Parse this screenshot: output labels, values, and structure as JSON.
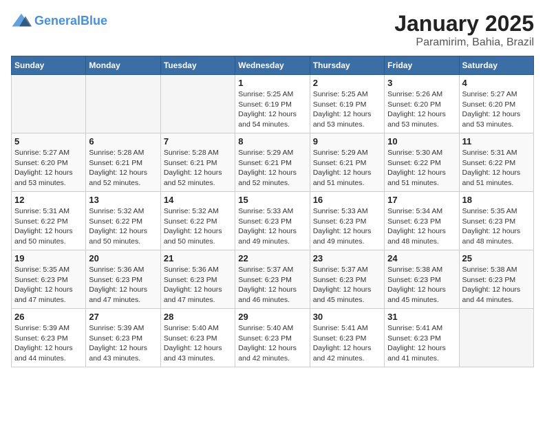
{
  "logo": {
    "line1": "General",
    "line2": "Blue"
  },
  "title": "January 2025",
  "subtitle": "Paramirim, Bahia, Brazil",
  "days_of_week": [
    "Sunday",
    "Monday",
    "Tuesday",
    "Wednesday",
    "Thursday",
    "Friday",
    "Saturday"
  ],
  "weeks": [
    [
      {
        "day": "",
        "info": ""
      },
      {
        "day": "",
        "info": ""
      },
      {
        "day": "",
        "info": ""
      },
      {
        "day": "1",
        "info": "Sunrise: 5:25 AM\nSunset: 6:19 PM\nDaylight: 12 hours\nand 54 minutes."
      },
      {
        "day": "2",
        "info": "Sunrise: 5:25 AM\nSunset: 6:19 PM\nDaylight: 12 hours\nand 53 minutes."
      },
      {
        "day": "3",
        "info": "Sunrise: 5:26 AM\nSunset: 6:20 PM\nDaylight: 12 hours\nand 53 minutes."
      },
      {
        "day": "4",
        "info": "Sunrise: 5:27 AM\nSunset: 6:20 PM\nDaylight: 12 hours\nand 53 minutes."
      }
    ],
    [
      {
        "day": "5",
        "info": "Sunrise: 5:27 AM\nSunset: 6:20 PM\nDaylight: 12 hours\nand 53 minutes."
      },
      {
        "day": "6",
        "info": "Sunrise: 5:28 AM\nSunset: 6:21 PM\nDaylight: 12 hours\nand 52 minutes."
      },
      {
        "day": "7",
        "info": "Sunrise: 5:28 AM\nSunset: 6:21 PM\nDaylight: 12 hours\nand 52 minutes."
      },
      {
        "day": "8",
        "info": "Sunrise: 5:29 AM\nSunset: 6:21 PM\nDaylight: 12 hours\nand 52 minutes."
      },
      {
        "day": "9",
        "info": "Sunrise: 5:29 AM\nSunset: 6:21 PM\nDaylight: 12 hours\nand 51 minutes."
      },
      {
        "day": "10",
        "info": "Sunrise: 5:30 AM\nSunset: 6:22 PM\nDaylight: 12 hours\nand 51 minutes."
      },
      {
        "day": "11",
        "info": "Sunrise: 5:31 AM\nSunset: 6:22 PM\nDaylight: 12 hours\nand 51 minutes."
      }
    ],
    [
      {
        "day": "12",
        "info": "Sunrise: 5:31 AM\nSunset: 6:22 PM\nDaylight: 12 hours\nand 50 minutes."
      },
      {
        "day": "13",
        "info": "Sunrise: 5:32 AM\nSunset: 6:22 PM\nDaylight: 12 hours\nand 50 minutes."
      },
      {
        "day": "14",
        "info": "Sunrise: 5:32 AM\nSunset: 6:22 PM\nDaylight: 12 hours\nand 50 minutes."
      },
      {
        "day": "15",
        "info": "Sunrise: 5:33 AM\nSunset: 6:23 PM\nDaylight: 12 hours\nand 49 minutes."
      },
      {
        "day": "16",
        "info": "Sunrise: 5:33 AM\nSunset: 6:23 PM\nDaylight: 12 hours\nand 49 minutes."
      },
      {
        "day": "17",
        "info": "Sunrise: 5:34 AM\nSunset: 6:23 PM\nDaylight: 12 hours\nand 48 minutes."
      },
      {
        "day": "18",
        "info": "Sunrise: 5:35 AM\nSunset: 6:23 PM\nDaylight: 12 hours\nand 48 minutes."
      }
    ],
    [
      {
        "day": "19",
        "info": "Sunrise: 5:35 AM\nSunset: 6:23 PM\nDaylight: 12 hours\nand 47 minutes."
      },
      {
        "day": "20",
        "info": "Sunrise: 5:36 AM\nSunset: 6:23 PM\nDaylight: 12 hours\nand 47 minutes."
      },
      {
        "day": "21",
        "info": "Sunrise: 5:36 AM\nSunset: 6:23 PM\nDaylight: 12 hours\nand 47 minutes."
      },
      {
        "day": "22",
        "info": "Sunrise: 5:37 AM\nSunset: 6:23 PM\nDaylight: 12 hours\nand 46 minutes."
      },
      {
        "day": "23",
        "info": "Sunrise: 5:37 AM\nSunset: 6:23 PM\nDaylight: 12 hours\nand 45 minutes."
      },
      {
        "day": "24",
        "info": "Sunrise: 5:38 AM\nSunset: 6:23 PM\nDaylight: 12 hours\nand 45 minutes."
      },
      {
        "day": "25",
        "info": "Sunrise: 5:38 AM\nSunset: 6:23 PM\nDaylight: 12 hours\nand 44 minutes."
      }
    ],
    [
      {
        "day": "26",
        "info": "Sunrise: 5:39 AM\nSunset: 6:23 PM\nDaylight: 12 hours\nand 44 minutes."
      },
      {
        "day": "27",
        "info": "Sunrise: 5:39 AM\nSunset: 6:23 PM\nDaylight: 12 hours\nand 43 minutes."
      },
      {
        "day": "28",
        "info": "Sunrise: 5:40 AM\nSunset: 6:23 PM\nDaylight: 12 hours\nand 43 minutes."
      },
      {
        "day": "29",
        "info": "Sunrise: 5:40 AM\nSunset: 6:23 PM\nDaylight: 12 hours\nand 42 minutes."
      },
      {
        "day": "30",
        "info": "Sunrise: 5:41 AM\nSunset: 6:23 PM\nDaylight: 12 hours\nand 42 minutes."
      },
      {
        "day": "31",
        "info": "Sunrise: 5:41 AM\nSunset: 6:23 PM\nDaylight: 12 hours\nand 41 minutes."
      },
      {
        "day": "",
        "info": ""
      }
    ]
  ]
}
